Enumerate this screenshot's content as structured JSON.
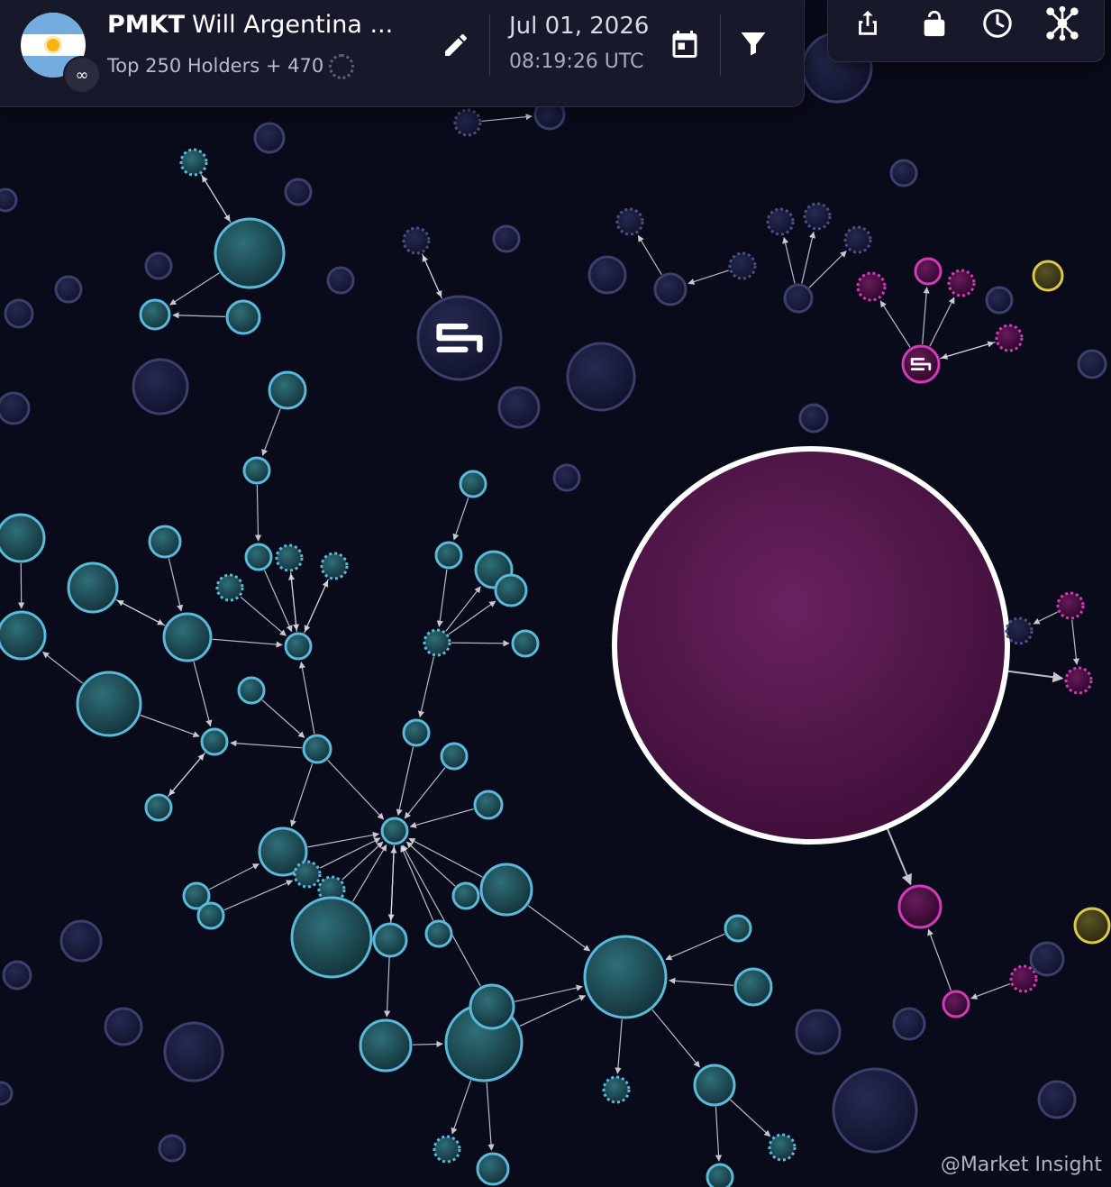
{
  "header": {
    "token_symbol": "PMKT",
    "market_title": "Will Argentina ...",
    "holders_summary": "Top 250 Holders + 470",
    "date": "Jul 01, 2026",
    "time": "08:19:26 UTC"
  },
  "watermark": "@Market Insight",
  "colors": {
    "background": "#0a0b1a",
    "cluster_blue_fill": "#1f4a55",
    "cluster_blue_stroke": "#5ab8d8",
    "inactive_fill": "#1a1c3a",
    "inactive_stroke": "#3b3f6a",
    "magenta_stroke": "#d23ab8",
    "magenta_fill": "#4a1040",
    "whale_fill": "#5a1a52",
    "yellow_stroke": "#d9c84a"
  },
  "icons": [
    "edit-icon",
    "calendar-icon",
    "filter-icon",
    "share-icon",
    "lock-icon",
    "clock-icon",
    "network-icon",
    "link-icon"
  ]
}
